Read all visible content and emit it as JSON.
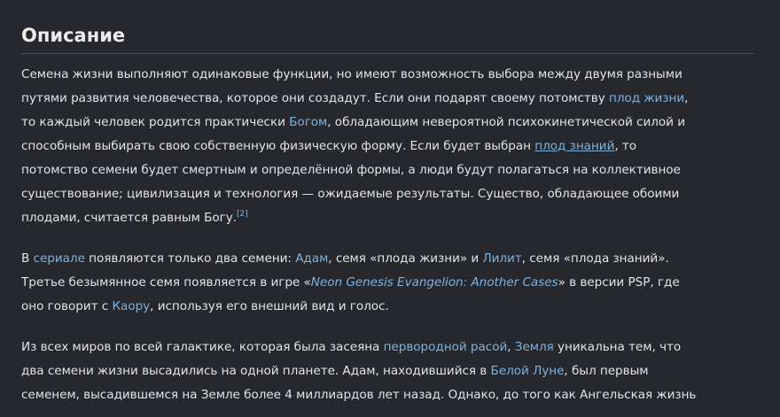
{
  "section": {
    "title": "Описание"
  },
  "p1": {
    "l1": "Семена жизни выполняют одинаковые функции, но имеют возможность выбора между двумя разными",
    "l2a": "путями развития человечества, которое они создадут. Если они подарят своему потомству ",
    "l2_link": "плод жизни",
    "l2b": ",",
    "l3a": "то каждый человек родится практически ",
    "l3_link": "Богом",
    "l3b": ", обладающим невероятной психокинетической силой и",
    "l4a": "способным выбирать свою собственную физическую форму. Если будет выбран ",
    "l4_link": "плод знаний",
    "l4b": ", то",
    "l5": "потомство семени будет смертным и определённой формы, а люди будут полагаться на коллективное",
    "l6": "существование; цивилизация и технология — ожидаемые результаты. Существо, обладающее обоими",
    "l7": "плодами, считается равным Богу.",
    "ref": "[2]"
  },
  "p2": {
    "l1a": "В ",
    "l1_link1": "сериале",
    "l1b": " появляются только два семени: ",
    "l1_link2": "Адам",
    "l1c": ", семя «плода жизни» и ",
    "l1_link3": "Лилит",
    "l1d": ", семя «плода знаний».",
    "l2a": "Третье безымянное семя появляется в игре «",
    "l2_red": "Neon Genesis Evangelion: Another Cases",
    "l2b": "» в версии PSP, где",
    "l3a": "оно говорит с ",
    "l3_link": "Каору",
    "l3b": ", используя его внешний вид и голос."
  },
  "p3": {
    "l1a": "Из всех миров по всей галактике, которая была засеяна ",
    "l1_link1": "первородной расой",
    "l1b": ", ",
    "l1_link2": "Земля",
    "l1c": " уникальна тем, что",
    "l2a": "два семени жизни высадились на одной планете. Адам, находившийся в ",
    "l2_link": "Белой Луне",
    "l2b": ", был первым",
    "l3": "семенем, высадившемся на Земле более 4 миллиардов лет назад. Однако, до того как Ангельская жизнь"
  },
  "colors": {
    "background": "#26282d",
    "text": "#e4e4e4",
    "link": "#7fb2dd",
    "red_link": "#e0282d",
    "rule": "#4a4d53"
  }
}
